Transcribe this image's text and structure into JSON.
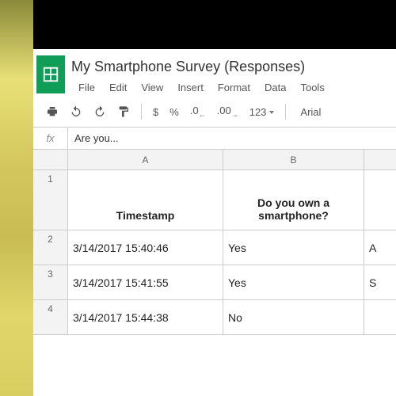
{
  "doc": {
    "title": "My Smartphone Survey (Responses)"
  },
  "menu": {
    "file": "File",
    "edit": "Edit",
    "view": "View",
    "insert": "Insert",
    "format": "Format",
    "data": "Data",
    "tools": "Tools"
  },
  "toolbar": {
    "currency": "$",
    "percent": "%",
    "dec_dec": ".0",
    "dec_inc": ".00",
    "num_fmt": "123",
    "font": "Arial"
  },
  "formula": {
    "label": "fx",
    "value": "Are you..."
  },
  "columns": {
    "A": "A",
    "B": "B",
    "C": ""
  },
  "rows": {
    "r1": "1",
    "r2": "2",
    "r3": "3",
    "r4": "4"
  },
  "headers": {
    "A": "Timestamp",
    "B": "Do you own a smartphone?",
    "C": ""
  },
  "data": [
    {
      "A": "3/14/2017 15:40:46",
      "B": "Yes",
      "C": "A"
    },
    {
      "A": "3/14/2017 15:41:55",
      "B": "Yes",
      "C": "S"
    },
    {
      "A": "3/14/2017 15:44:38",
      "B": "No",
      "C": ""
    }
  ]
}
